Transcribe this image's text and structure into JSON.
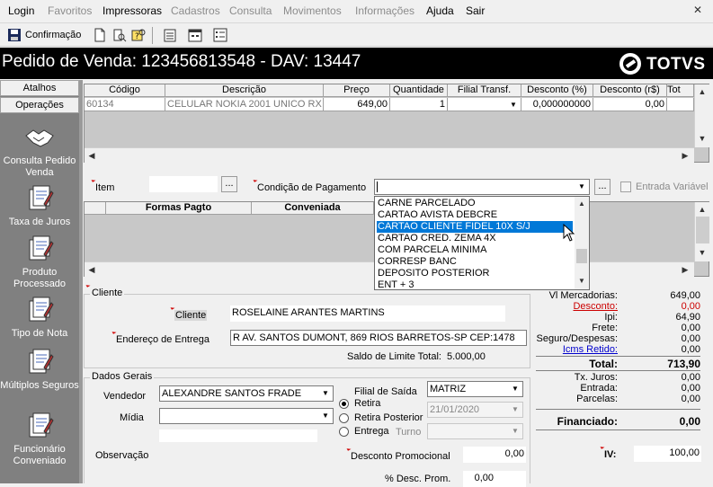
{
  "menu": {
    "items": [
      {
        "label": "Login",
        "enabled": true
      },
      {
        "label": "Favoritos",
        "enabled": false
      },
      {
        "label": "Impressoras",
        "enabled": true
      },
      {
        "label": "Cadastros",
        "enabled": false
      },
      {
        "label": "Consulta",
        "enabled": false
      },
      {
        "label": "Movimentos",
        "enabled": false
      },
      {
        "label": "Informações",
        "enabled": false
      },
      {
        "label": "Ajuda",
        "enabled": true
      },
      {
        "label": "Sair",
        "enabled": true
      }
    ]
  },
  "toolbar": {
    "confirm_label": "Confirmação"
  },
  "title": {
    "text": "Pedido de Venda: 123456813548  - DAV: 13447",
    "logo": "TOTVS"
  },
  "left_panel": {
    "tabs": [
      "Atalhos",
      "Operações"
    ],
    "items": [
      {
        "label": "Consulta Pedido Venda",
        "icon": "handshake-icon"
      },
      {
        "label": "Taxa de Juros",
        "icon": "document-pen-icon"
      },
      {
        "label": "Produto Processado",
        "icon": "document-pen-icon"
      },
      {
        "label": "Tipo de Nota",
        "icon": "document-pen-icon"
      },
      {
        "label": "Múltiplos Seguros",
        "icon": "document-pen-icon"
      },
      {
        "label": "Funcionário Conveniado",
        "icon": "document-pen-icon"
      }
    ]
  },
  "products_grid": {
    "headers": [
      "Código",
      "Descrição",
      "Preço",
      "Quantidade",
      "Filial Transf.",
      "Desconto (%)",
      "Desconto (r$)",
      "Tot"
    ],
    "row": [
      "60134",
      "CELULAR NOKIA 2001 UNICO  RX",
      "649,00",
      "1",
      "",
      "0,000000000",
      "0,00",
      ""
    ]
  },
  "item_label": "Item",
  "condicao_label": "Condição de Pagamento",
  "entrada_variavel_label": "Entrada Variável",
  "payments_grid": {
    "headers": [
      "Formas Pagto",
      "Conveniada"
    ]
  },
  "dropdown": {
    "options": [
      "CARNE PARCELADO",
      "CARTAO AVISTA DEBCRE",
      "CARTAO CLIENTE FIDEL 10X S/J",
      "CARTAO CRED. ZEMA 4X",
      "COM PARCELA MINIMA",
      "CORRESP BANC",
      "DEPOSITO POSTERIOR",
      "ENT + 3"
    ],
    "selected_index": 2
  },
  "cliente": {
    "group_label": "Cliente",
    "label": "Cliente",
    "value": "ROSELAINE ARANTES MARTINS",
    "endereco_label": "Endereço de Entrega",
    "endereco_value": "R  AV. SANTOS DUMONT, 869  RIOS BARRETOS-SP CEP:1478",
    "saldo_label": "Saldo de Limite Total:",
    "saldo_value": "5.000,00"
  },
  "dados_gerais": {
    "group_label": "Dados Gerais",
    "vendedor_label": "Vendedor",
    "vendedor_value": "ALEXANDRE SANTOS FRADE",
    "midia_label": "Mídia",
    "midia_value": "",
    "observacao_label": "Observação",
    "filial_label": "Filial de Saída",
    "filial_value": "MATRIZ",
    "retira_label": "Retira",
    "retira_posterior_label": "Retira Posterior",
    "entrega_label": "Entrega",
    "turno_label": "Turno",
    "date_value": "21/01/2020",
    "desconto_promocional_label": "Desconto Promocional",
    "desconto_promocional_value": "0,00",
    "perc_desc_prom_label": "% Desc. Prom.",
    "perc_desc_prom_value": "0,00"
  },
  "totals": {
    "rows": [
      {
        "label": "Vl Mercadorias:",
        "value": "649,00"
      },
      {
        "label": "Desconto:",
        "value": "0,00"
      },
      {
        "label": "Ipi:",
        "value": "64,90"
      },
      {
        "label": "Frete:",
        "value": "0,00"
      },
      {
        "label": "Seguro/Despesas:",
        "value": "0,00"
      },
      {
        "label": "Icms Retido:",
        "value": "0,00"
      }
    ],
    "total_label": "Total:",
    "total_value": "713,90",
    "rows2": [
      {
        "label": "Tx. Juros:",
        "value": "0,00"
      },
      {
        "label": "Entrada:",
        "value": "0,00"
      },
      {
        "label": "Parcelas:",
        "value": "0,00"
      }
    ],
    "financiado_label": "Financiado:",
    "financiado_value": "0,00",
    "iv_label": "IV:",
    "iv_value": "100,00",
    "colors": {
      "desconto": "#cc0000",
      "link": "#0000cc"
    }
  }
}
